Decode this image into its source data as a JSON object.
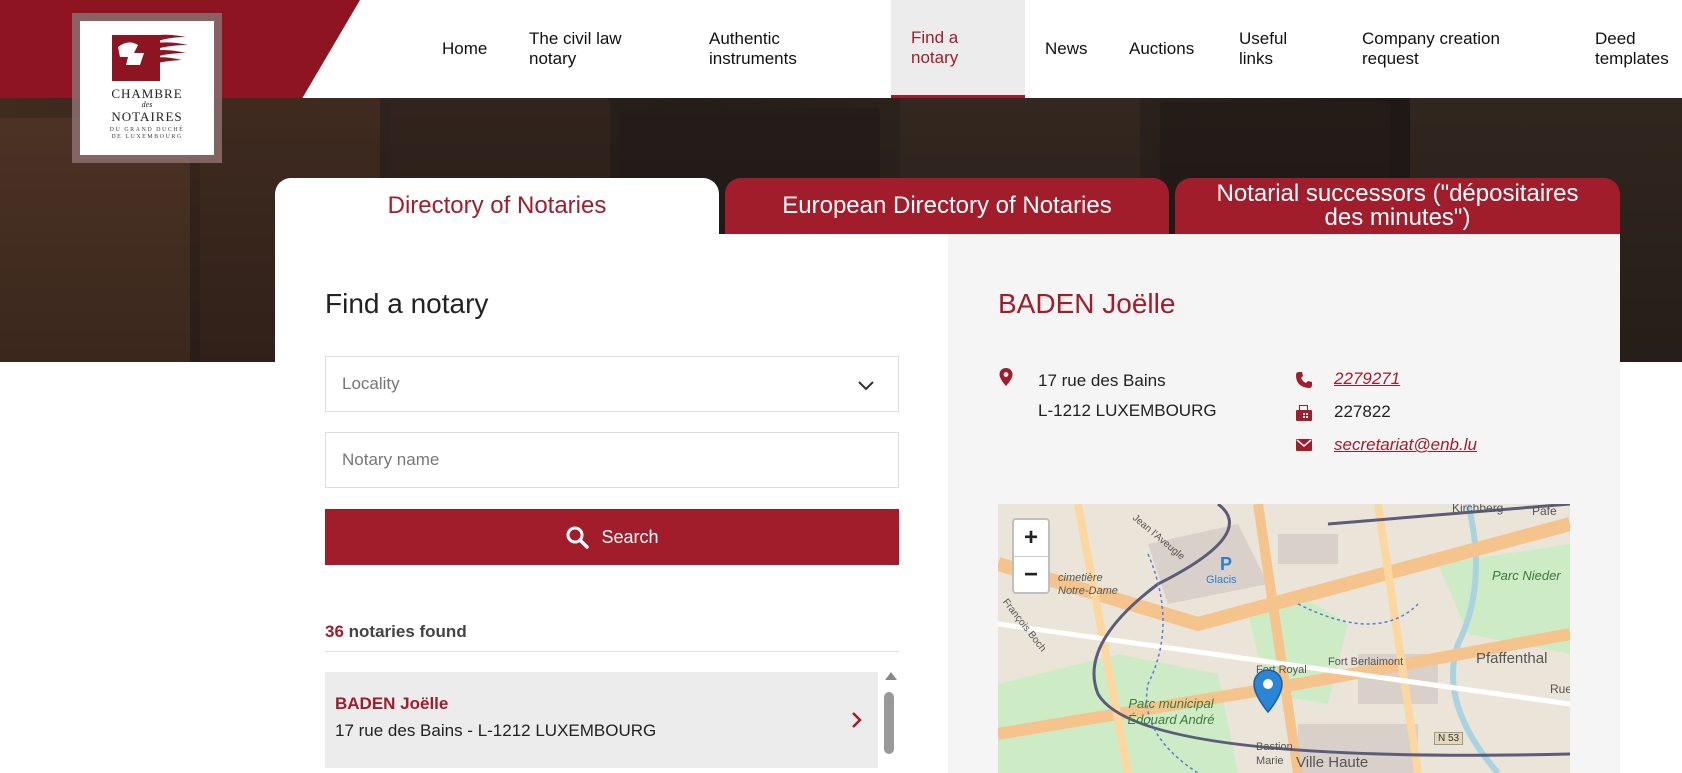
{
  "logo": {
    "line1": "CHAMBRE",
    "line2": "des",
    "line3": "NOTAIRES",
    "line4": "DU GRAND DUCHÉ",
    "line5": "DE LUXEMBOURG"
  },
  "nav": {
    "items": [
      {
        "label": "Home"
      },
      {
        "label": "The civil law notary"
      },
      {
        "label": "Authentic instruments"
      },
      {
        "label": "Find a notary",
        "active": true
      },
      {
        "label": "News"
      },
      {
        "label": "Auctions"
      },
      {
        "label": "Useful links"
      },
      {
        "label": "Company creation request"
      },
      {
        "label": "Deed templates"
      }
    ]
  },
  "tabs": [
    {
      "label": "Directory of Notaries",
      "active": true
    },
    {
      "label": "European Directory of Notaries"
    },
    {
      "label": "Notarial successors (\"dépositaires des minutes\")"
    }
  ],
  "search": {
    "title": "Find a notary",
    "locality_placeholder": "Locality",
    "name_placeholder": "Notary name",
    "button_label": "Search",
    "found_count": "36",
    "found_text": " notaries found"
  },
  "results": [
    {
      "name": "BADEN Joëlle",
      "address": "17 rue des Bains - L-1212 LUXEMBOURG"
    }
  ],
  "detail": {
    "name": "BADEN Joëlle",
    "address_line1": "17 rue des Bains",
    "address_line2": "L-1212 LUXEMBOURG",
    "phone": "2279271",
    "fax": "227822",
    "email": "secretariat@enb.lu"
  },
  "map": {
    "zoom_in": "+",
    "zoom_out": "−",
    "labels": {
      "kirchberg": "Kirchberg",
      "pfaffenthal": "Pfaffenthal",
      "parc_nieder": "Parc Nieder",
      "glacis": "Glacis",
      "parking": "P",
      "cemetery": "cimetière Notre-Dame",
      "jean_aveugle": "Jean l'Aveugle",
      "francois_boch": "François Boch",
      "fort_royal": "Fort Royal",
      "fort_berlaimont": "Fort Berlaimont",
      "parc_municipal": "Parc municipal Édouard André",
      "bastion_marie": "Bastion Marie",
      "ville_haute": "Ville Haute",
      "n53": "N 53",
      "rue": "Rue",
      "pafe": "Pafe"
    }
  },
  "colors": {
    "brand_red": "#a11d2b",
    "header_red": "#8e1422"
  }
}
